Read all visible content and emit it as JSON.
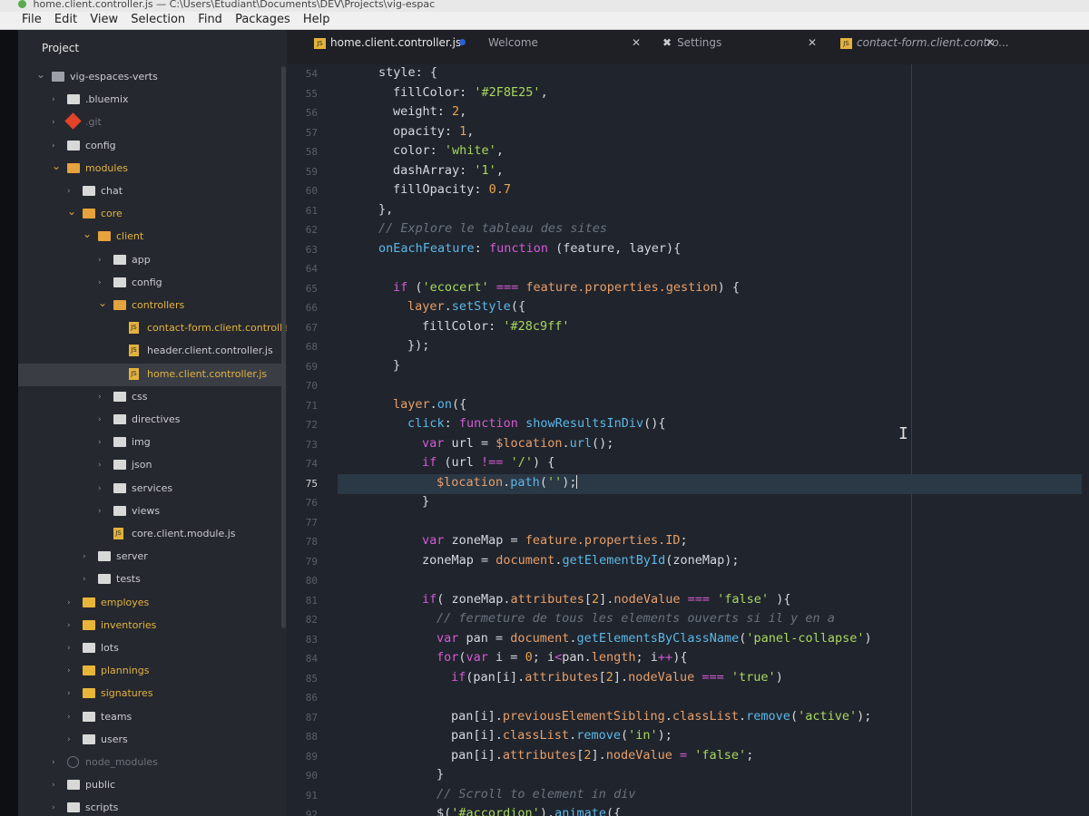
{
  "window": {
    "title": "home.client.controller.js — C:\\Users\\Etudiant\\Documents\\DEV\\Projects\\vig-espac"
  },
  "menu": [
    "File",
    "Edit",
    "View",
    "Selection",
    "Find",
    "Packages",
    "Help"
  ],
  "tree": {
    "header": "Project",
    "items": [
      {
        "label": "vig-espaces-verts",
        "depth": 0,
        "kind": "repo",
        "chev": "down",
        "style": "normal"
      },
      {
        "label": ".bluemix",
        "depth": 1,
        "kind": "folder",
        "chev": "right",
        "style": "normal"
      },
      {
        "label": ".git",
        "depth": 1,
        "kind": "git",
        "chev": "right",
        "style": "dim"
      },
      {
        "label": "config",
        "depth": 1,
        "kind": "folder",
        "chev": "right",
        "style": "normal"
      },
      {
        "label": "modules",
        "depth": 1,
        "kind": "folder-open",
        "chev": "down",
        "style": "yellow"
      },
      {
        "label": "chat",
        "depth": 2,
        "kind": "folder",
        "chev": "right",
        "style": "normal"
      },
      {
        "label": "core",
        "depth": 2,
        "kind": "folder-open",
        "chev": "down",
        "style": "yellow"
      },
      {
        "label": "client",
        "depth": 3,
        "kind": "folder-open",
        "chev": "down",
        "style": "yellow"
      },
      {
        "label": "app",
        "depth": 4,
        "kind": "folder",
        "chev": "right",
        "style": "normal"
      },
      {
        "label": "config",
        "depth": 4,
        "kind": "folder",
        "chev": "right",
        "style": "normal"
      },
      {
        "label": "controllers",
        "depth": 4,
        "kind": "folder-open",
        "chev": "down",
        "style": "yellow"
      },
      {
        "label": "contact-form.client.controller.js",
        "depth": 5,
        "kind": "js",
        "chev": "",
        "style": "yellow"
      },
      {
        "label": "header.client.controller.js",
        "depth": 5,
        "kind": "js",
        "chev": "",
        "style": "normal"
      },
      {
        "label": "home.client.controller.js",
        "depth": 5,
        "kind": "js",
        "chev": "",
        "style": "yellow",
        "selected": true
      },
      {
        "label": "css",
        "depth": 4,
        "kind": "folder",
        "chev": "right",
        "style": "normal"
      },
      {
        "label": "directives",
        "depth": 4,
        "kind": "folder",
        "chev": "right",
        "style": "normal"
      },
      {
        "label": "img",
        "depth": 4,
        "kind": "folder",
        "chev": "right",
        "style": "normal"
      },
      {
        "label": "json",
        "depth": 4,
        "kind": "folder",
        "chev": "right",
        "style": "normal"
      },
      {
        "label": "services",
        "depth": 4,
        "kind": "folder",
        "chev": "right",
        "style": "normal"
      },
      {
        "label": "views",
        "depth": 4,
        "kind": "folder",
        "chev": "right",
        "style": "normal"
      },
      {
        "label": "core.client.module.js",
        "depth": 4,
        "kind": "js",
        "chev": "",
        "style": "normal"
      },
      {
        "label": "server",
        "depth": 3,
        "kind": "folder",
        "chev": "right",
        "style": "normal"
      },
      {
        "label": "tests",
        "depth": 3,
        "kind": "folder",
        "chev": "right",
        "style": "normal"
      },
      {
        "label": "employes",
        "depth": 2,
        "kind": "folder-yellow",
        "chev": "right",
        "style": "yellow"
      },
      {
        "label": "inventories",
        "depth": 2,
        "kind": "folder-yellow",
        "chev": "right",
        "style": "yellow"
      },
      {
        "label": "lots",
        "depth": 2,
        "kind": "folder",
        "chev": "right",
        "style": "normal"
      },
      {
        "label": "plannings",
        "depth": 2,
        "kind": "folder-yellow",
        "chev": "right",
        "style": "yellow"
      },
      {
        "label": "signatures",
        "depth": 2,
        "kind": "folder-yellow",
        "chev": "right",
        "style": "yellow"
      },
      {
        "label": "teams",
        "depth": 2,
        "kind": "folder",
        "chev": "right",
        "style": "normal"
      },
      {
        "label": "users",
        "depth": 2,
        "kind": "folder",
        "chev": "right",
        "style": "normal"
      },
      {
        "label": "node_modules",
        "depth": 1,
        "kind": "pkg",
        "chev": "right",
        "style": "dim"
      },
      {
        "label": "public",
        "depth": 1,
        "kind": "folder",
        "chev": "right",
        "style": "normal"
      },
      {
        "label": "scripts",
        "depth": 1,
        "kind": "folder",
        "chev": "right",
        "style": "normal"
      }
    ]
  },
  "tabs": [
    {
      "label": "home.client.controller.js",
      "icon": "js-file-icon",
      "active": true,
      "modified": true
    },
    {
      "label": "Welcome",
      "icon": "",
      "active": false
    },
    {
      "label": "Settings",
      "icon": "tools-icon",
      "active": false
    },
    {
      "label": "contact-form.client.contro...",
      "icon": "js-file-icon",
      "active": false
    }
  ],
  "editor": {
    "current_line": 75,
    "lines": [
      {
        "n": 54,
        "ind": 0,
        "t": [
          [
            "style: {",
            ""
          ]
        ]
      },
      {
        "n": 55,
        "ind": 1,
        "t": [
          [
            "fillColor: ",
            ""
          ],
          [
            "'#2F8E25'",
            "s"
          ],
          [
            ",",
            ""
          ]
        ]
      },
      {
        "n": 56,
        "ind": 1,
        "t": [
          [
            "weight: ",
            ""
          ],
          [
            "2",
            "n"
          ],
          [
            ",",
            ""
          ]
        ]
      },
      {
        "n": 57,
        "ind": 1,
        "t": [
          [
            "opacity: ",
            ""
          ],
          [
            "1",
            "n"
          ],
          [
            ",",
            ""
          ]
        ]
      },
      {
        "n": 58,
        "ind": 1,
        "t": [
          [
            "color: ",
            ""
          ],
          [
            "'white'",
            "s"
          ],
          [
            ",",
            ""
          ]
        ]
      },
      {
        "n": 59,
        "ind": 1,
        "t": [
          [
            "dashArray: ",
            ""
          ],
          [
            "'1'",
            "s"
          ],
          [
            ",",
            ""
          ]
        ]
      },
      {
        "n": 60,
        "ind": 1,
        "t": [
          [
            "fillOpacity: ",
            ""
          ],
          [
            "0.7",
            "n"
          ]
        ]
      },
      {
        "n": 61,
        "ind": 0,
        "t": [
          [
            "},",
            ""
          ]
        ]
      },
      {
        "n": 62,
        "ind": 0,
        "t": [
          [
            "// Explore le tableau des sites",
            "c"
          ]
        ]
      },
      {
        "n": 63,
        "ind": 0,
        "t": [
          [
            "onEachFeature",
            "f"
          ],
          [
            ": ",
            ""
          ],
          [
            "function",
            "k"
          ],
          [
            " (feature, layer){",
            ""
          ]
        ]
      },
      {
        "n": 64,
        "ind": 0,
        "t": []
      },
      {
        "n": 65,
        "ind": 1,
        "t": [
          [
            "if",
            "k"
          ],
          [
            " (",
            ""
          ],
          [
            "'ecocert'",
            "s"
          ],
          [
            " === ",
            "k"
          ],
          [
            "feature.properties.gestion",
            "p"
          ],
          [
            ") {",
            ""
          ]
        ]
      },
      {
        "n": 66,
        "ind": 2,
        "t": [
          [
            "layer",
            "p"
          ],
          [
            ".",
            ""
          ],
          [
            "setStyle",
            "f"
          ],
          [
            "({",
            ""
          ]
        ]
      },
      {
        "n": 67,
        "ind": 3,
        "t": [
          [
            "fillColor: ",
            ""
          ],
          [
            "'#28c9ff'",
            "s"
          ]
        ]
      },
      {
        "n": 68,
        "ind": 2,
        "t": [
          [
            "});",
            ""
          ]
        ]
      },
      {
        "n": 69,
        "ind": 1,
        "t": [
          [
            "}",
            ""
          ]
        ]
      },
      {
        "n": 70,
        "ind": 0,
        "t": []
      },
      {
        "n": 71,
        "ind": 1,
        "t": [
          [
            "layer",
            "p"
          ],
          [
            ".",
            ""
          ],
          [
            "on",
            "f"
          ],
          [
            "({",
            ""
          ]
        ]
      },
      {
        "n": 72,
        "ind": 2,
        "t": [
          [
            "click",
            "f"
          ],
          [
            ": ",
            ""
          ],
          [
            "function",
            "k"
          ],
          [
            " ",
            ""
          ],
          [
            "showResultsInDiv",
            "f"
          ],
          [
            "(){",
            ""
          ]
        ]
      },
      {
        "n": 73,
        "ind": 3,
        "t": [
          [
            "var",
            "k"
          ],
          [
            " url = ",
            ""
          ],
          [
            "$location",
            "p"
          ],
          [
            ".",
            ""
          ],
          [
            "url",
            "f"
          ],
          [
            "();",
            ""
          ]
        ]
      },
      {
        "n": 74,
        "ind": 3,
        "t": [
          [
            "if",
            "k"
          ],
          [
            " (url ",
            ""
          ],
          [
            "!==",
            "k"
          ],
          [
            " ",
            ""
          ],
          [
            "'/'",
            "s"
          ],
          [
            ") {",
            ""
          ]
        ]
      },
      {
        "n": 75,
        "ind": 4,
        "t": [
          [
            "$location",
            "p"
          ],
          [
            ".",
            ""
          ],
          [
            "path",
            "f"
          ],
          [
            "(",
            ""
          ],
          [
            "''",
            "s"
          ],
          [
            ");",
            ""
          ]
        ],
        "caret": true
      },
      {
        "n": 76,
        "ind": 3,
        "t": [
          [
            "}",
            ""
          ]
        ]
      },
      {
        "n": 77,
        "ind": 0,
        "t": []
      },
      {
        "n": 78,
        "ind": 3,
        "t": [
          [
            "var",
            "k"
          ],
          [
            " zoneMap = ",
            ""
          ],
          [
            "feature.properties.ID",
            "p"
          ],
          [
            ";",
            ""
          ]
        ]
      },
      {
        "n": 79,
        "ind": 3,
        "t": [
          [
            "zoneMap = ",
            ""
          ],
          [
            "document",
            "p"
          ],
          [
            ".",
            ""
          ],
          [
            "getElementById",
            "f"
          ],
          [
            "(zoneMap);",
            ""
          ]
        ]
      },
      {
        "n": 80,
        "ind": 0,
        "t": []
      },
      {
        "n": 81,
        "ind": 3,
        "t": [
          [
            "if",
            "k"
          ],
          [
            "( zoneMap.",
            ""
          ],
          [
            "attributes",
            "p"
          ],
          [
            "[",
            ""
          ],
          [
            "2",
            "n"
          ],
          [
            "].",
            ""
          ],
          [
            "nodeValue",
            "p"
          ],
          [
            " === ",
            "k"
          ],
          [
            "'false'",
            "s"
          ],
          [
            " ){",
            ""
          ]
        ]
      },
      {
        "n": 82,
        "ind": 4,
        "t": [
          [
            "// fermeture de tous les elements ouverts si il y en a",
            "c"
          ]
        ]
      },
      {
        "n": 83,
        "ind": 4,
        "t": [
          [
            "var",
            "k"
          ],
          [
            " pan = ",
            ""
          ],
          [
            "document",
            "p"
          ],
          [
            ".",
            ""
          ],
          [
            "getElementsByClassName",
            "f"
          ],
          [
            "(",
            ""
          ],
          [
            "'panel-collapse'",
            "s"
          ],
          [
            ")",
            ""
          ]
        ]
      },
      {
        "n": 84,
        "ind": 4,
        "t": [
          [
            "for",
            "k"
          ],
          [
            "(",
            ""
          ],
          [
            "var",
            "k"
          ],
          [
            " i = ",
            ""
          ],
          [
            "0",
            "n"
          ],
          [
            "; i",
            ""
          ],
          [
            "<",
            "k"
          ],
          [
            "pan.",
            ""
          ],
          [
            "length",
            "p"
          ],
          [
            "; i",
            ""
          ],
          [
            "++",
            "k"
          ],
          [
            "){",
            ""
          ]
        ]
      },
      {
        "n": 85,
        "ind": 5,
        "t": [
          [
            "if",
            "k"
          ],
          [
            "(pan[i].",
            ""
          ],
          [
            "attributes",
            "p"
          ],
          [
            "[",
            ""
          ],
          [
            "2",
            "n"
          ],
          [
            "].",
            ""
          ],
          [
            "nodeValue",
            "p"
          ],
          [
            " === ",
            "k"
          ],
          [
            "'true'",
            "s"
          ],
          [
            ")",
            ""
          ]
        ]
      },
      {
        "n": 86,
        "ind": 0,
        "t": []
      },
      {
        "n": 87,
        "ind": 5,
        "t": [
          [
            "pan[i].",
            ""
          ],
          [
            "previousElementSibling",
            "p"
          ],
          [
            ".",
            ""
          ],
          [
            "classList",
            "p"
          ],
          [
            ".",
            ""
          ],
          [
            "remove",
            "f"
          ],
          [
            "(",
            ""
          ],
          [
            "'active'",
            "s"
          ],
          [
            ");",
            ""
          ]
        ]
      },
      {
        "n": 88,
        "ind": 5,
        "t": [
          [
            "pan[i].",
            ""
          ],
          [
            "classList",
            "p"
          ],
          [
            ".",
            ""
          ],
          [
            "remove",
            "f"
          ],
          [
            "(",
            ""
          ],
          [
            "'in'",
            "s"
          ],
          [
            ");",
            ""
          ]
        ]
      },
      {
        "n": 89,
        "ind": 5,
        "t": [
          [
            "pan[i].",
            ""
          ],
          [
            "attributes",
            "p"
          ],
          [
            "[",
            ""
          ],
          [
            "2",
            "n"
          ],
          [
            "].",
            ""
          ],
          [
            "nodeValue",
            "p"
          ],
          [
            " = ",
            "k"
          ],
          [
            "'false'",
            "s"
          ],
          [
            ";",
            ""
          ]
        ]
      },
      {
        "n": 90,
        "ind": 4,
        "t": [
          [
            "}",
            ""
          ]
        ]
      },
      {
        "n": 91,
        "ind": 4,
        "t": [
          [
            "// Scroll to element in div",
            "c"
          ]
        ]
      },
      {
        "n": 92,
        "ind": 4,
        "t": [
          [
            "$(",
            ""
          ],
          [
            "'#accordion'",
            "s"
          ],
          [
            ").",
            ""
          ],
          [
            "animate",
            "f"
          ],
          [
            "({",
            ""
          ]
        ]
      }
    ]
  }
}
